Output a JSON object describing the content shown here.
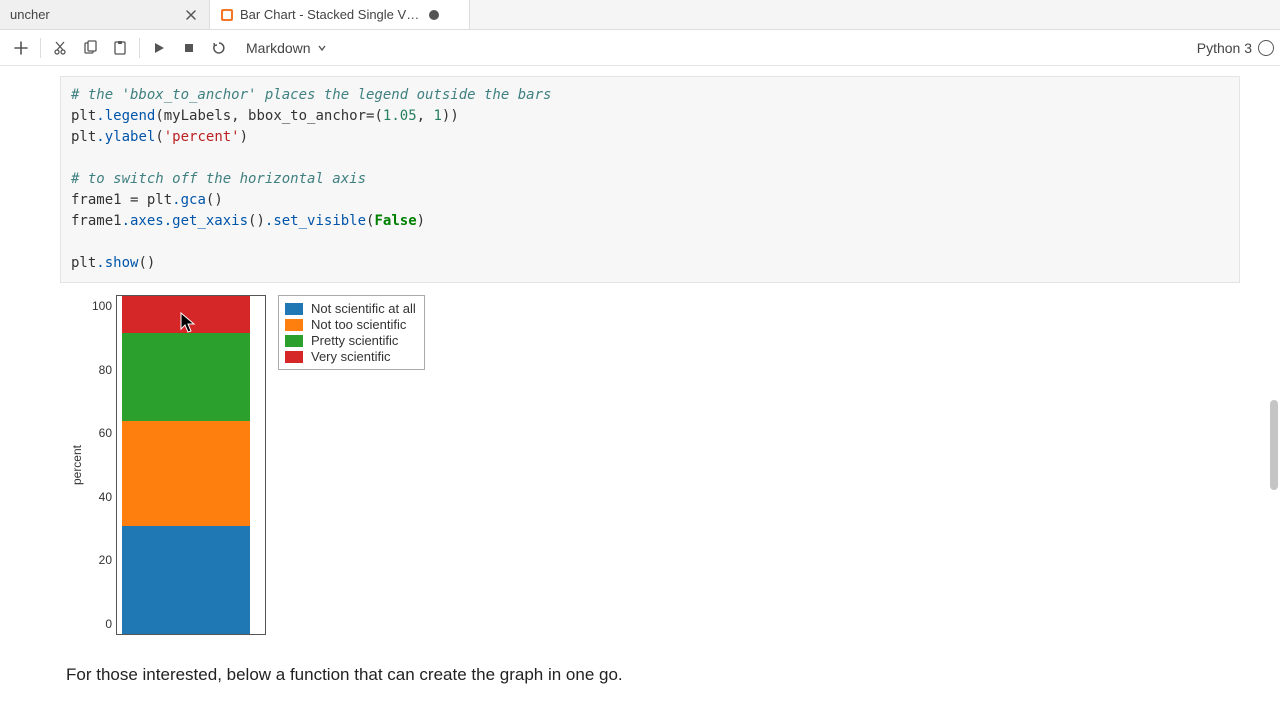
{
  "tabs": [
    {
      "label": "uncher",
      "active": false,
      "has_close": true
    },
    {
      "label": "Bar Chart - Stacked Single V…",
      "active": true,
      "dirty": true
    }
  ],
  "toolbar": {
    "cell_type": "Markdown",
    "kernel": "Python 3"
  },
  "code": {
    "l1": "# the 'bbox_to_anchor' places the legend outside the bars",
    "l2a": "plt",
    "l2b": ".legend",
    "l2c": "(myLabels, bbox_to_anchor",
    "l2d": "=",
    "l2e": "(",
    "l2f": "1.05",
    "l2g": ", ",
    "l2h": "1",
    "l2i": "))",
    "l3a": "plt",
    "l3b": ".ylabel",
    "l3c": "(",
    "l3d": "'percent'",
    "l3e": ")",
    "l4": "",
    "l5": "# to switch off the horizontal axis",
    "l6a": "frame1 ",
    "l6b": "=",
    "l6c": " plt",
    "l6d": ".gca",
    "l6e": "()",
    "l7a": "frame1",
    "l7b": ".axes",
    "l7c": ".get_xaxis",
    "l7d": "()",
    "l7e": ".set_visible",
    "l7f": "(",
    "l7g": "False",
    "l7h": ")",
    "l8": "",
    "l9a": "plt",
    "l9b": ".show",
    "l9c": "()"
  },
  "chart_data": {
    "type": "bar_stacked",
    "ylabel": "percent",
    "ylim": [
      0,
      100
    ],
    "yticks": [
      0,
      20,
      40,
      60,
      80,
      100
    ],
    "xaxis_visible": false,
    "legend_position": "outside-right",
    "series": [
      {
        "name": "Not scientific at all",
        "value": 32,
        "color": "#1f77b4"
      },
      {
        "name": "Not too scientific",
        "value": 31,
        "color": "#ff7f0e"
      },
      {
        "name": "Pretty scientific",
        "value": 26,
        "color": "#2ca02c"
      },
      {
        "name": "Very scientific",
        "value": 11,
        "color": "#d62728"
      }
    ]
  },
  "yticks": {
    "t100": "100",
    "t80": "80",
    "t60": "60",
    "t40": "40",
    "t20": "20",
    "t0": "0"
  },
  "legend": {
    "r0": "Not scientific at all",
    "r1": "Not too scientific",
    "r2": "Pretty scientific",
    "r3": "Very scientific"
  },
  "note": "For those interested, below a function that can create the graph in one go."
}
